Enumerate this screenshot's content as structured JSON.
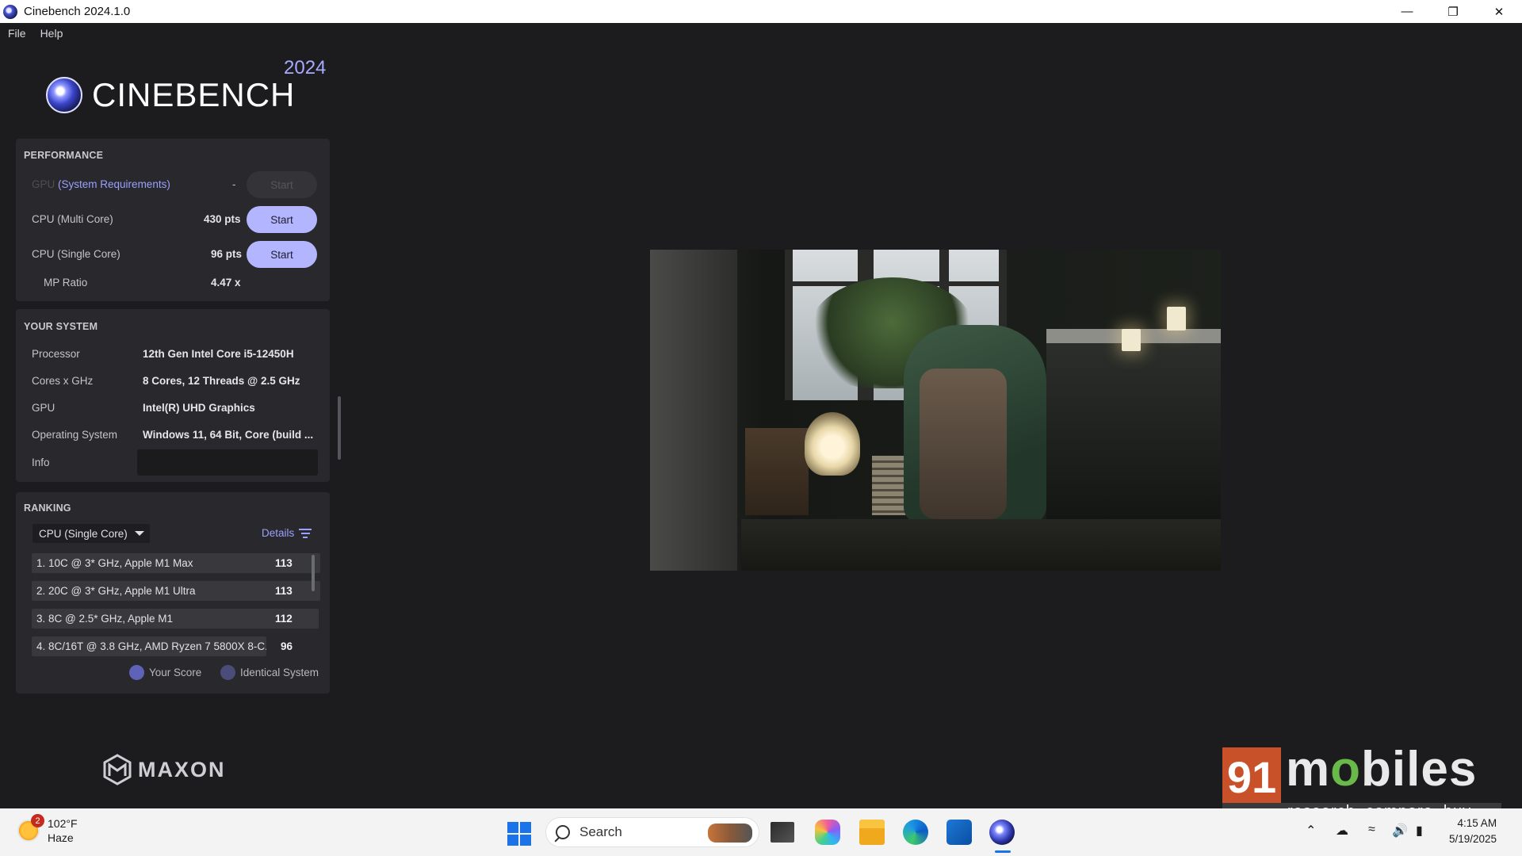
{
  "window": {
    "title": "Cinebench 2024.1.0"
  },
  "menu": [
    "File",
    "Help"
  ],
  "logo": {
    "word": "CINEBENCH",
    "year": "2024"
  },
  "performance": {
    "title": "PERFORMANCE",
    "gpu": {
      "label_dim": "GPU",
      "label_link": "(System Requirements)",
      "value": "-",
      "button": "Start"
    },
    "multi": {
      "label": "CPU (Multi Core)",
      "value": "430 pts",
      "button": "Start"
    },
    "single": {
      "label": "CPU (Single Core)",
      "value": "96 pts",
      "button": "Start"
    },
    "mp": {
      "label": "MP Ratio",
      "value": "4.47 x"
    }
  },
  "system": {
    "title": "YOUR SYSTEM",
    "rows": [
      {
        "label": "Processor",
        "value": "12th Gen Intel Core i5-12450H"
      },
      {
        "label": "Cores x GHz",
        "value": "8 Cores, 12 Threads @ 2.5 GHz"
      },
      {
        "label": "GPU",
        "value": "Intel(R) UHD Graphics"
      },
      {
        "label": "Operating System",
        "value": "Windows 11, 64 Bit, Core (build ..."
      },
      {
        "label": "Info",
        "value": ""
      }
    ]
  },
  "ranking": {
    "title": "RANKING",
    "selected": "CPU (Single Core)",
    "details": "Details",
    "rows": [
      {
        "name": "1. 10C @ 3* GHz, Apple M1 Max",
        "score": "113"
      },
      {
        "name": "2. 20C @ 3* GHz, Apple M1 Ultra",
        "score": "113"
      },
      {
        "name": "3. 8C @ 2.5* GHz, Apple M1",
        "score": "112"
      },
      {
        "name": "4. 8C/16T @ 3.8 GHz, AMD Ryzen 7 5800X 8-C...",
        "score": "96"
      }
    ],
    "legend": [
      {
        "label": "Your Score",
        "color": "#5f63b8"
      },
      {
        "label": "Identical System",
        "color": "#4a4d7a"
      }
    ]
  },
  "maxon": "MAXON",
  "watermark": {
    "number": "91",
    "brand_pre": "m",
    "brand_o": "o",
    "brand_post": "biles",
    "tagline": "research. compare. buy."
  },
  "taskbar": {
    "weather": {
      "badge": "2",
      "temp": "102°F",
      "condition": "Haze"
    },
    "search": "Search",
    "time": "4:15 AM",
    "date": "5/19/2025"
  },
  "colors": {
    "accent": "#b3b6ff",
    "link": "#9aa0ff",
    "panel": "#29292d",
    "bg": "#1c1c1e"
  }
}
